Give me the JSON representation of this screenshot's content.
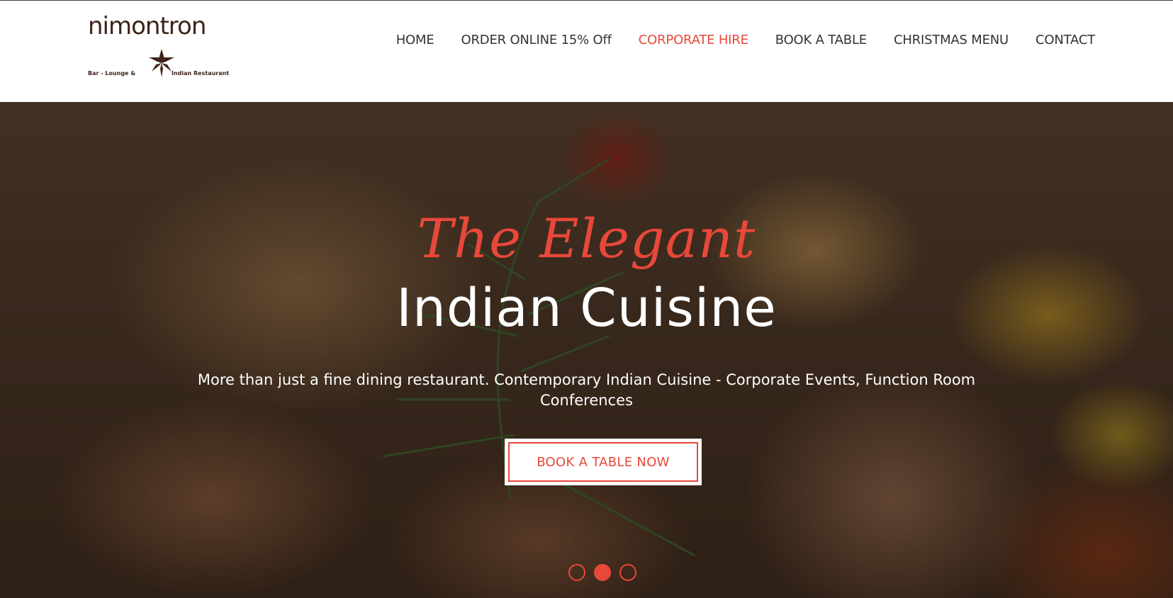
{
  "brand": {
    "logo_text": "nimontron",
    "tagline_left": "Bar - Lounge &",
    "tagline_right": "Indian Restaurant"
  },
  "nav": {
    "items": [
      {
        "label": "HOME",
        "active": false
      },
      {
        "label": "ORDER ONLINE 15% Off",
        "active": false
      },
      {
        "label": "CORPORATE HIRE",
        "active": true
      },
      {
        "label": "BOOK A TABLE",
        "active": false
      },
      {
        "label": "CHRISTMAS MENU",
        "active": false
      },
      {
        "label": "CONTACT",
        "active": false
      }
    ]
  },
  "hero": {
    "script_title": "The Elegant",
    "main_title": "Indian Cuisine",
    "subtitle": "More than just a fine dining restaurant. Contemporary Indian Cuisine - Corporate Events, Function Room Conferences",
    "cta_label": "BOOK A TABLE NOW",
    "slides_total": 3,
    "active_slide": 2
  },
  "colors": {
    "accent": "#e8483a",
    "brand_brown": "#3d2418",
    "nav_text": "#333333"
  }
}
